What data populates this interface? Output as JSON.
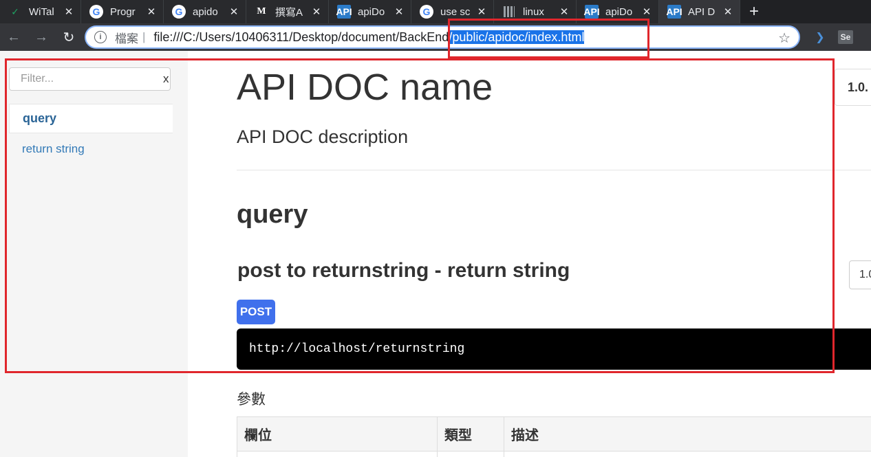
{
  "browser": {
    "tabs": [
      {
        "title": "WiTal",
        "favicon": "check-icon",
        "active": false
      },
      {
        "title": "Progr",
        "favicon": "google-icon",
        "active": false
      },
      {
        "title": "apido",
        "favicon": "google-icon",
        "active": false
      },
      {
        "title": "撰寫A",
        "favicon": "medium-icon",
        "active": false
      },
      {
        "title": "apiDo",
        "favicon": "apidoc-icon",
        "active": false
      },
      {
        "title": "use sc",
        "favicon": "google-icon",
        "active": false
      },
      {
        "title": "linux",
        "favicon": "bars-icon",
        "active": false
      },
      {
        "title": "apiDo",
        "favicon": "apidoc-icon",
        "active": false
      },
      {
        "title": "API D",
        "favicon": "apidoc-icon",
        "active": true
      }
    ],
    "favicon_glyphs": {
      "check": "✓",
      "google": "G",
      "medium": "M",
      "apidoc": "API"
    },
    "close_glyph": "✕",
    "new_tab_glyph": "+",
    "address": {
      "scheme_label": "檔案",
      "separator": "|",
      "url_prefix": "file:///C:/Users/10406311/Desktop/document/BackEnd",
      "url_selected": "/public/apidoc/index.html"
    },
    "extensions": [
      {
        "name": "bird-extension-icon",
        "glyph": "❯"
      },
      {
        "name": "selenium-extension-icon",
        "glyph": "Se"
      }
    ],
    "nav_glyphs": {
      "back": "←",
      "forward": "→",
      "reload": "↻",
      "info": "i",
      "star": "☆"
    }
  },
  "sidebar": {
    "filter": {
      "placeholder": "Filter...",
      "clear_label": "x"
    },
    "groups": [
      {
        "label": "query",
        "items": [
          {
            "label": "return string"
          }
        ]
      }
    ]
  },
  "main": {
    "title": "API DOC name",
    "description": "API DOC description",
    "version": "1.0.",
    "group": "query",
    "api": {
      "title": "post to returnstring - return string",
      "version": "1.0",
      "method": "POST",
      "url": "http://localhost/returnstring",
      "params_title": "參數",
      "params_headers": [
        "欄位",
        "類型",
        "描述"
      ]
    }
  },
  "colors": {
    "annotation": "#e0262c",
    "method_badge": "#4070ec",
    "link": "#337ab7",
    "selection": "#1a73e8"
  }
}
